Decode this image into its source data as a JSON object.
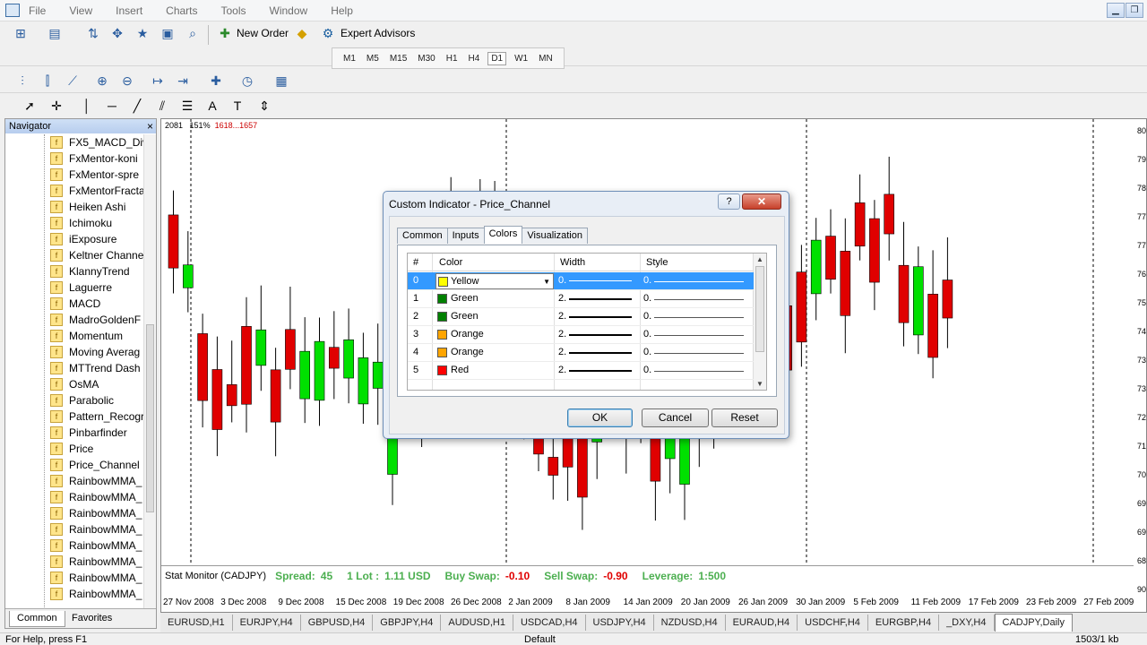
{
  "menu": [
    "File",
    "View",
    "Insert",
    "Charts",
    "Tools",
    "Window",
    "Help"
  ],
  "toolbar": {
    "new_order": "New Order",
    "expert_advisors": "Expert Advisors"
  },
  "periods": [
    "M1",
    "M5",
    "M15",
    "M30",
    "H1",
    "H4",
    "D1",
    "W1",
    "MN"
  ],
  "active_period": "D1",
  "navigator": {
    "title": "Navigator",
    "items": [
      "FX5_MACD_Div",
      "FxMentor-koni",
      "FxMentor-spre",
      "FxMentorFracta",
      "Heiken Ashi",
      "Ichimoku",
      "iExposure",
      "Keltner Channe",
      "KlannyTrend",
      "Laguerre",
      "MACD",
      "MadroGoldenF",
      "Momentum",
      "Moving Averag",
      "MTTrend Dash",
      "OsMA",
      "Parabolic",
      "Pattern_Recogr",
      "Pinbarfinder",
      "Price",
      "Price_Channel",
      "RainbowMMA_",
      "RainbowMMA_",
      "RainbowMMA_",
      "RainbowMMA_",
      "RainbowMMA_",
      "RainbowMMA_",
      "RainbowMMA_",
      "RainbowMMA_"
    ],
    "tabs": [
      "Common",
      "Favorites"
    ]
  },
  "chart": {
    "info": {
      "number": "2081",
      "zoom": "151%",
      "range": "1618...1657"
    },
    "stat": {
      "title": "Stat Monitor (CADJPY)",
      "spread_label": "Spread:",
      "spread": "45",
      "lot_label": "1 Lot :",
      "lot": "1.11 USD",
      "buy_label": "Buy Swap:",
      "buy": "-0.10",
      "sell_label": "Sell Swap:",
      "sell": "-0.90",
      "lev_label": "Leverage:",
      "lev": "1:500"
    },
    "dates": [
      "27 Nov 2008",
      "3 Dec 2008",
      "9 Dec 2008",
      "15 Dec 2008",
      "19 Dec 2008",
      "26 Dec 2008",
      "2 Jan 2009",
      "8 Jan 2009",
      "14 Jan 2009",
      "20 Jan 2009",
      "26 Jan 2009",
      "30 Jan 2009",
      "5 Feb 2009",
      "11 Feb 2009",
      "17 Feb 2009",
      "23 Feb 2009",
      "27 Feb 2009"
    ],
    "prices": [
      "80",
      "79",
      "78",
      "77",
      "77",
      "76",
      "75",
      "74",
      "73",
      "73",
      "72",
      "71",
      "70",
      "69",
      "69",
      "68",
      "90"
    ]
  },
  "symbol_tabs": [
    "EURUSD,H1",
    "EURJPY,H4",
    "GBPUSD,H4",
    "GBPJPY,H4",
    "AUDUSD,H1",
    "USDCAD,H4",
    "USDJPY,H4",
    "NZDUSD,H4",
    "EURAUD,H4",
    "USDCHF,H4",
    "EURGBP,H4",
    "_DXY,H4",
    "CADJPY,Daily"
  ],
  "active_symbol": "CADJPY,Daily",
  "status": {
    "help": "For Help, press F1",
    "profile": "Default",
    "traffic": "1503/1 kb"
  },
  "dialog": {
    "title": "Custom Indicator - Price_Channel",
    "help_btn": "?",
    "tabs": [
      "Common",
      "Inputs",
      "Colors",
      "Visualization"
    ],
    "active_tab": "Colors",
    "columns": [
      "#",
      "Color",
      "Width",
      "Style"
    ],
    "rows": [
      {
        "idx": "0",
        "color": "Yellow",
        "hex": "#ffff00",
        "width": "0.",
        "style": "0."
      },
      {
        "idx": "1",
        "color": "Green",
        "hex": "#008000",
        "width": "2.",
        "style": "0."
      },
      {
        "idx": "2",
        "color": "Green",
        "hex": "#008000",
        "width": "2.",
        "style": "0."
      },
      {
        "idx": "3",
        "color": "Orange",
        "hex": "#ffa500",
        "width": "2.",
        "style": "0."
      },
      {
        "idx": "4",
        "color": "Orange",
        "hex": "#ffa500",
        "width": "2.",
        "style": "0."
      },
      {
        "idx": "5",
        "color": "Red",
        "hex": "#ff0000",
        "width": "2.",
        "style": "0."
      }
    ],
    "ok": "OK",
    "cancel": "Cancel",
    "reset": "Reset"
  },
  "colors": {
    "bull": "#00e000",
    "bear": "#e00000",
    "selection": "#3399ff"
  }
}
